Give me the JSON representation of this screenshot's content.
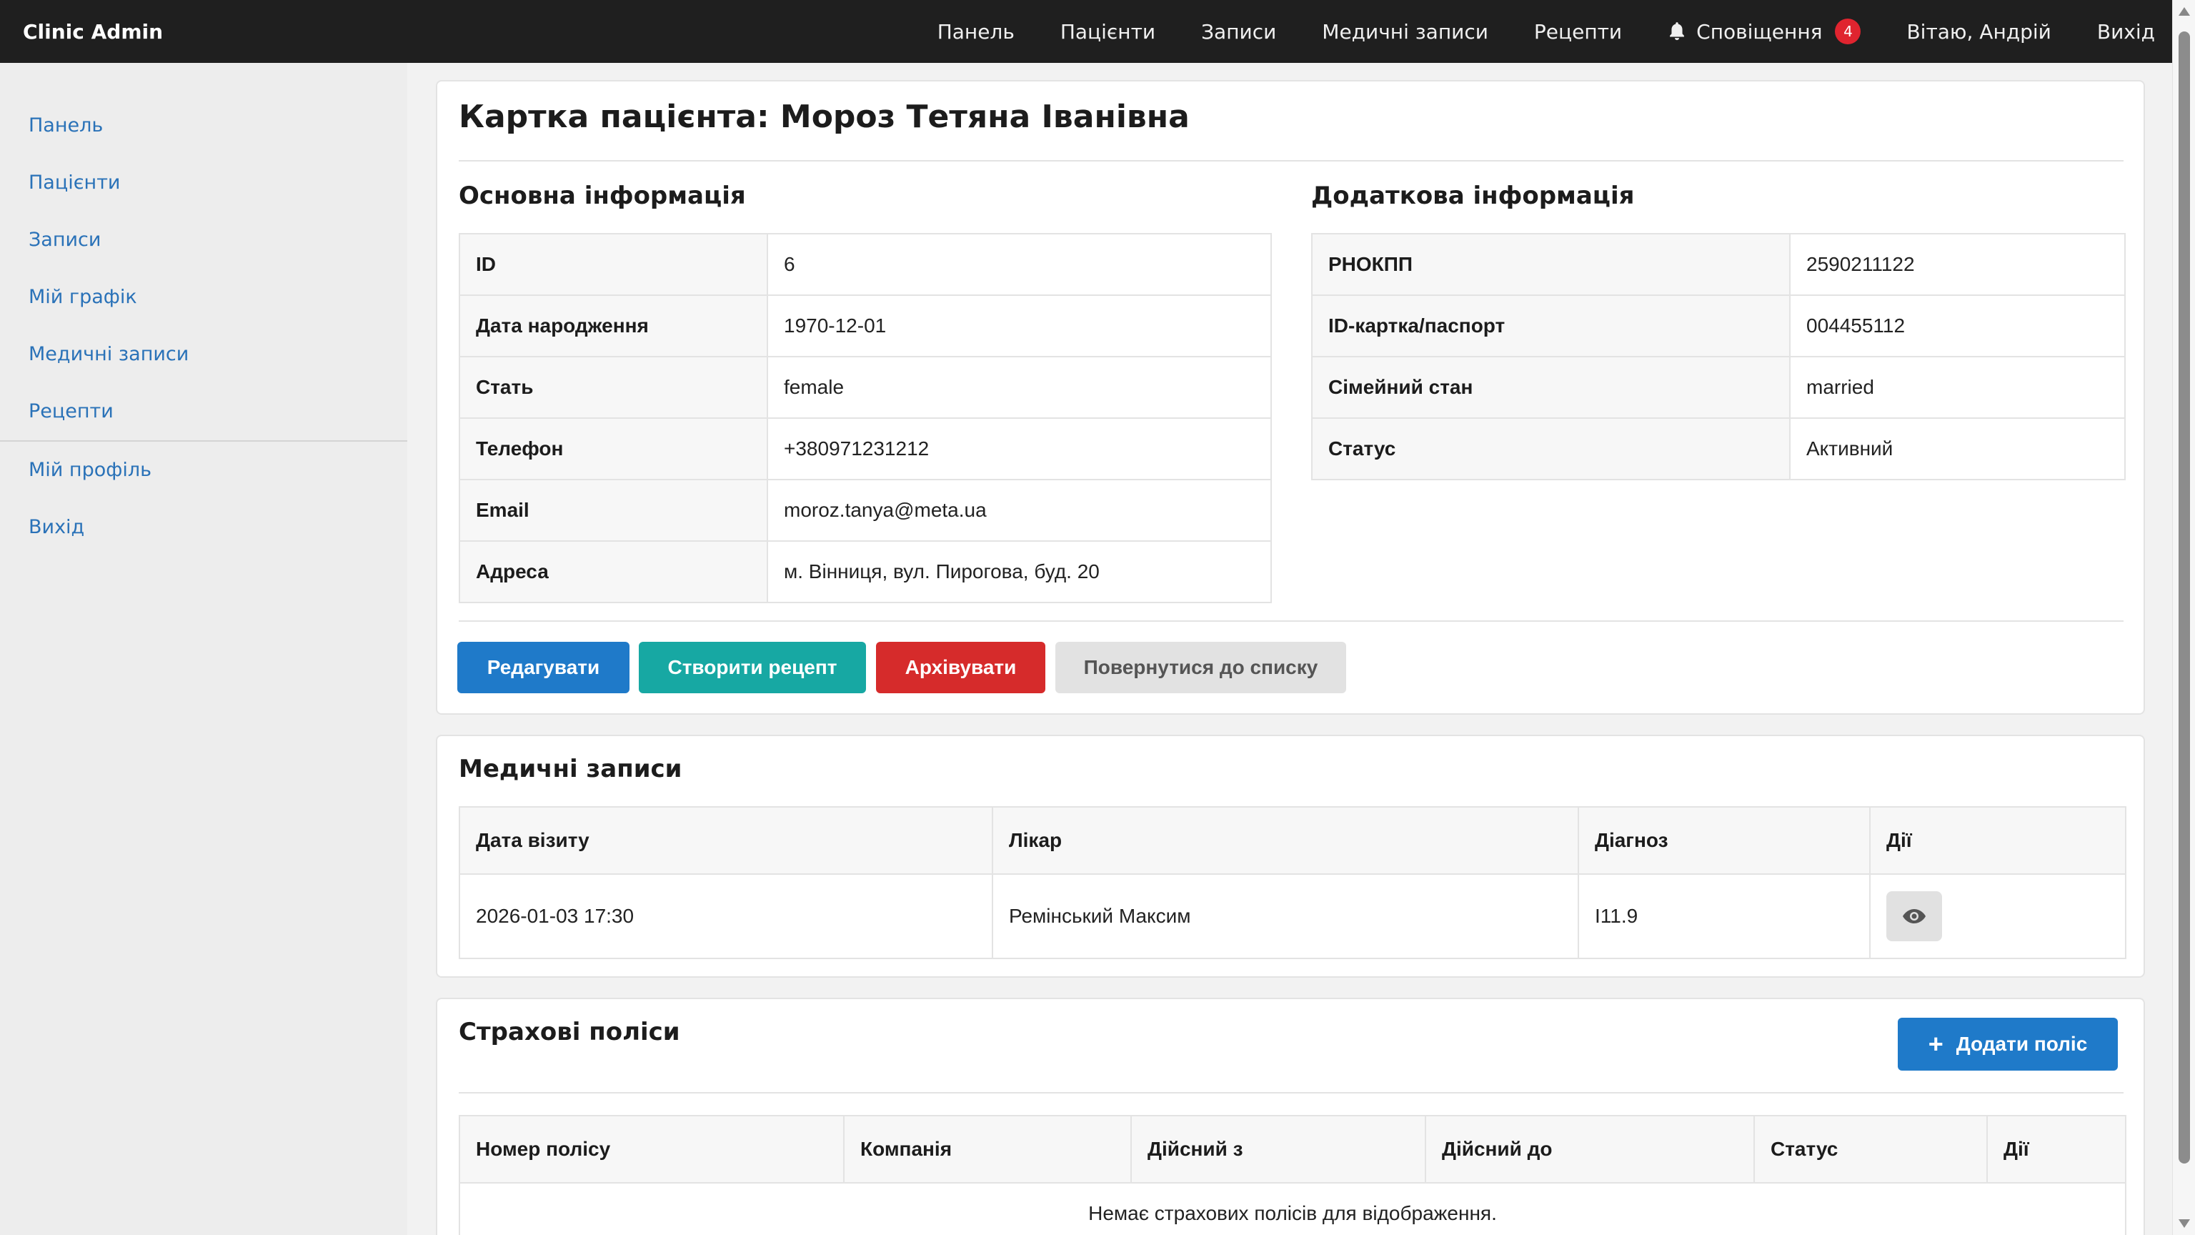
{
  "app": {
    "brand": "Clinic Admin"
  },
  "topnav": {
    "items": [
      "Панель",
      "Пацієнти",
      "Записи",
      "Медичні записи",
      "Рецепти"
    ],
    "notifications_label": "Сповіщення",
    "notifications_count": "4",
    "greeting": "Вітаю, Андрій",
    "logout": "Вихід"
  },
  "sidebar": {
    "items": [
      "Панель",
      "Пацієнти",
      "Записи",
      "Мій графік",
      "Медичні записи",
      "Рецепти"
    ],
    "items_bottom": [
      "Мій профіль",
      "Вихід"
    ]
  },
  "patient": {
    "title": "Картка пацієнта: Мороз Тетяна Іванівна",
    "basic_heading": "Основна інформація",
    "basic": [
      {
        "label": "ID",
        "value": "6"
      },
      {
        "label": "Дата народження",
        "value": "1970-12-01"
      },
      {
        "label": "Стать",
        "value": "female"
      },
      {
        "label": "Телефон",
        "value": "+380971231212"
      },
      {
        "label": "Email",
        "value": "moroz.tanya@meta.ua"
      },
      {
        "label": "Адреса",
        "value": "м. Вінниця, вул. Пирогова, буд. 20"
      }
    ],
    "extra_heading": "Додаткова інформація",
    "extra": [
      {
        "label": "РНОКПП",
        "value": "2590211122"
      },
      {
        "label": "ID-картка/паспорт",
        "value": "004455112"
      },
      {
        "label": "Сімейний стан",
        "value": "married"
      },
      {
        "label": "Статус",
        "value": "Активний"
      }
    ],
    "actions": {
      "edit": "Редагувати",
      "create_prescription": "Створити рецепт",
      "archive": "Архівувати",
      "back": "Повернутися до списку"
    }
  },
  "records": {
    "heading": "Медичні записи",
    "columns": [
      "Дата візиту",
      "Лікар",
      "Діагноз",
      "Дії"
    ],
    "rows": [
      {
        "date": "2026-01-03 17:30",
        "doctor": "Ремінський Максим",
        "diagnosis": "I11.9",
        "action_icon": "eye-icon"
      }
    ]
  },
  "policies": {
    "heading": "Страхові поліси",
    "add_label": "Додати поліс",
    "columns": [
      "Номер полісу",
      "Компанія",
      "Дійсний з",
      "Дійсний до",
      "Статус",
      "Дії"
    ],
    "empty": "Немає страхових полісів для відображення."
  },
  "colors": {
    "navbar": "#1f1f1f",
    "link": "#2a72b8",
    "primary": "#1f7ac9",
    "teal": "#17a8a3",
    "danger": "#d62b2b",
    "secondary": "#e2e2e2",
    "badge": "#e0242f"
  }
}
